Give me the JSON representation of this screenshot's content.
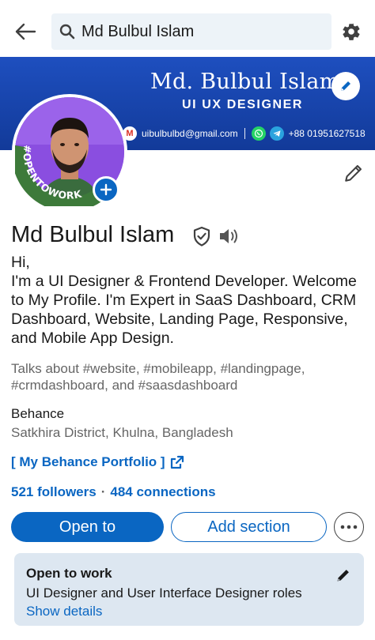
{
  "search": {
    "value": "Md Bulbul Islam"
  },
  "banner": {
    "name": "Md. Bulbul Islam",
    "role": "UI UX DESIGNER",
    "email": "uibulbulbd@gmail.com",
    "phone": "+88 01951627518",
    "colors": {
      "background": "#1642a8",
      "text": "#ffffff"
    }
  },
  "avatar": {
    "ring_text": "#OPENTOWORK",
    "ring_color": "#3d7a3a"
  },
  "profile": {
    "name": "Md Bulbul Islam",
    "headline_lines": [
      "Hi,",
      "I'm a UI Designer & Frontend Developer. Welcome",
      "to My Profile. I'm Expert in SaaS Dashboard, CRM",
      "Dashboard, Website, Landing Page, Responsive,",
      "and Mobile App Design."
    ],
    "talks_lines": [
      "Talks about #website, #mobileapp, #landingpage,",
      "#crmdashboard, and #saasdashboard"
    ],
    "company": "Behance",
    "location": "Satkhira District, Khulna, Bangladesh",
    "link_text": "[ My Behance Portfolio ]",
    "followers": "521 followers",
    "separator": "·",
    "connections": "484 connections"
  },
  "actions": {
    "open_to": "Open to",
    "add_section": "Add section"
  },
  "open_to_work": {
    "title": "Open to work",
    "description": "UI Designer and User Interface Designer roles",
    "details_link": "Show details"
  },
  "icons": {
    "back": "arrow-left-icon",
    "search": "search-icon",
    "settings": "gear-icon",
    "edit": "pencil-icon",
    "verified": "shield-check-icon",
    "pronunciation": "speaker-icon",
    "external": "external-link-icon",
    "more": "ellipsis-icon",
    "add": "plus-icon"
  },
  "colors": {
    "accent": "#0a66c2",
    "muted_text": "#666666",
    "card_bg": "#dde7f1"
  }
}
